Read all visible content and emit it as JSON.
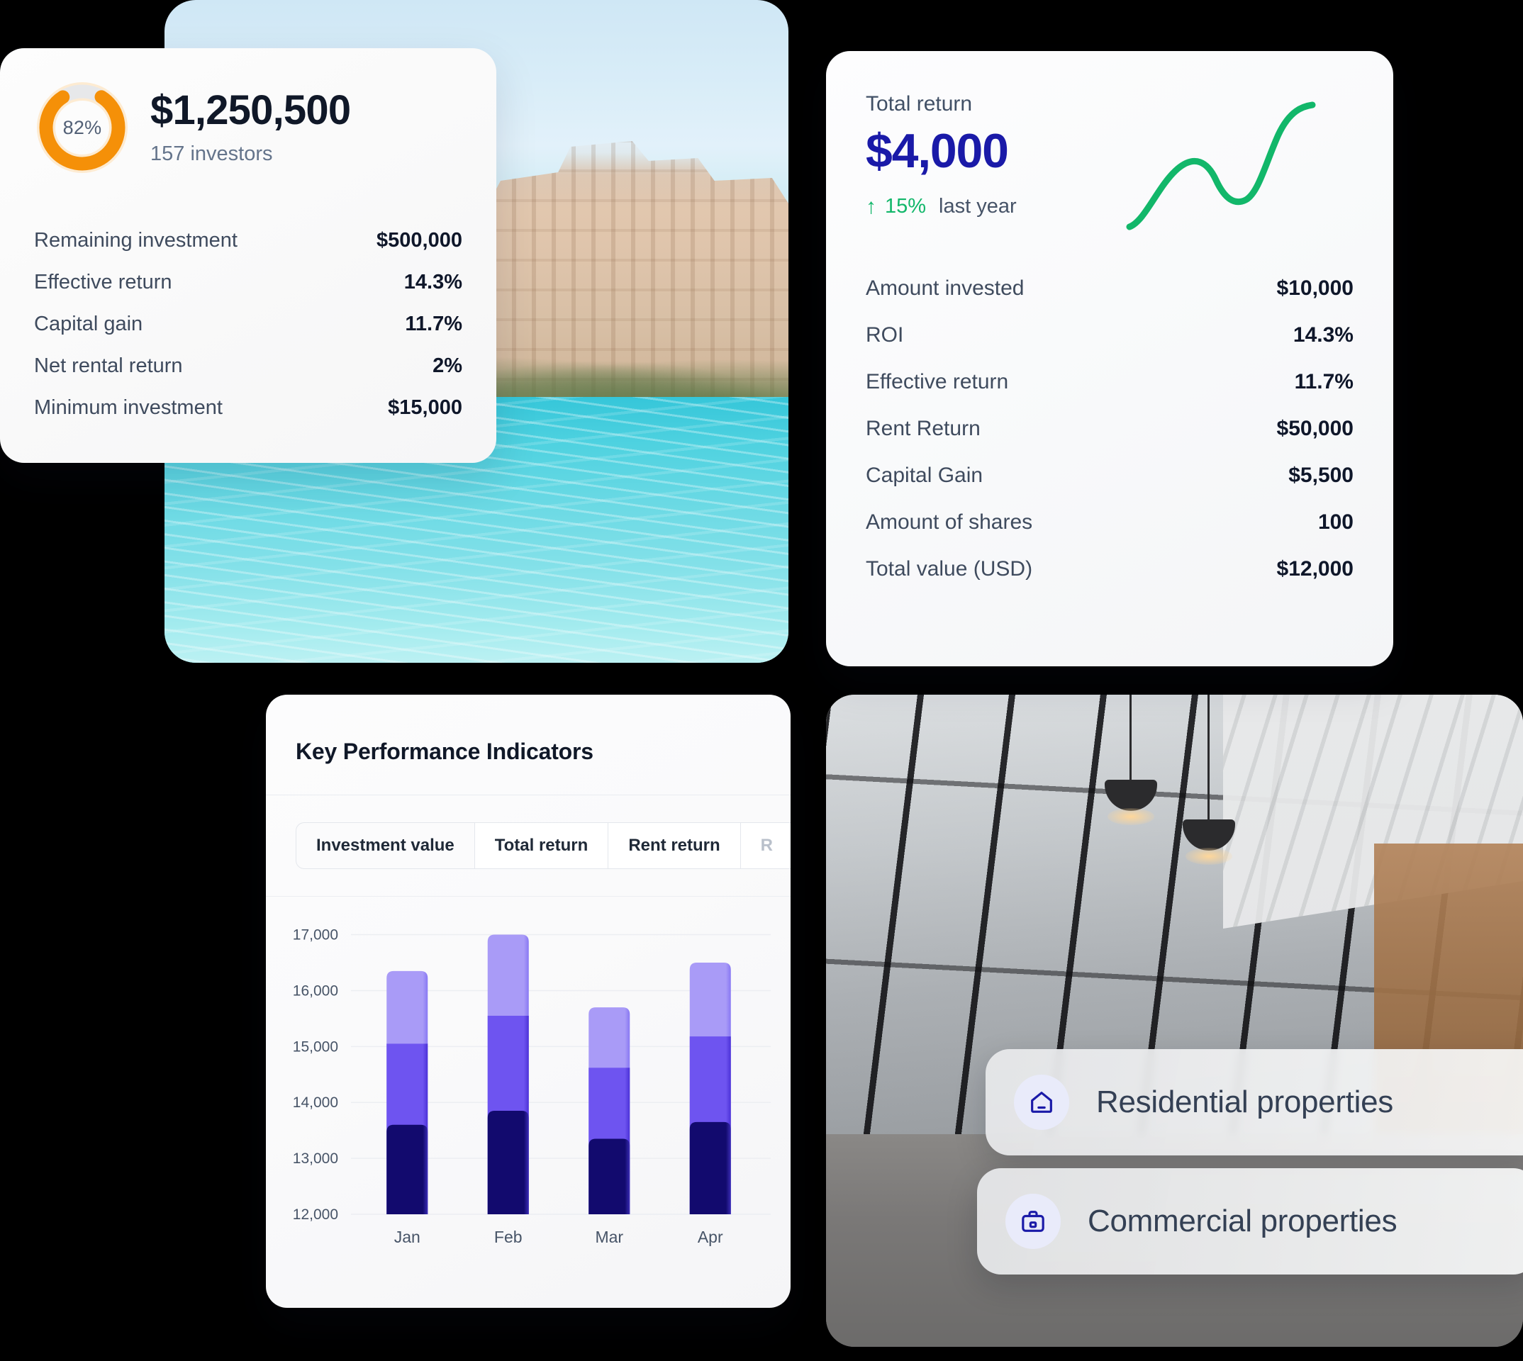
{
  "investment_card": {
    "progress_label": "82%",
    "progress_value": 82,
    "amount": "$1,250,500",
    "investors": "157 investors",
    "stats": [
      {
        "label": "Remaining investment",
        "value": "$500,000"
      },
      {
        "label": "Effective return",
        "value": "14.3%"
      },
      {
        "label": "Capital gain",
        "value": "11.7%"
      },
      {
        "label": "Net rental return",
        "value": "2%"
      },
      {
        "label": "Minimum investment",
        "value": "$15,000"
      }
    ]
  },
  "return_card": {
    "title": "Total return",
    "amount": "$4,000",
    "delta_arrow": "↑",
    "delta_value": "15%",
    "delta_period": "last year",
    "rows": [
      {
        "label": "Amount invested",
        "value": "$10,000"
      },
      {
        "label": "ROI",
        "value": "14.3%"
      },
      {
        "label": "Effective return",
        "value": "11.7%"
      },
      {
        "label": "Rent Return",
        "value": "$50,000"
      },
      {
        "label": "Capital Gain",
        "value": "$5,500"
      },
      {
        "label": "Amount of shares",
        "value": "100"
      },
      {
        "label": "Total value (USD)",
        "value": "$12,000"
      }
    ]
  },
  "kpi_card": {
    "title": "Key Performance Indicators",
    "tabs": [
      {
        "label": "Investment value",
        "active": true
      },
      {
        "label": "Total return",
        "active": false
      },
      {
        "label": "Rent return",
        "active": false
      },
      {
        "label": "R",
        "active": false
      }
    ]
  },
  "property_pills": [
    {
      "label": "Residential properties",
      "icon": "home-icon"
    },
    {
      "label": "Commercial properties",
      "icon": "briefcase-icon"
    }
  ],
  "colors": {
    "donut_accent": "#F59008",
    "donut_track": "#E7E8EA",
    "return_accent": "#1A1AA8",
    "positive": "#12B76A",
    "bar_bottom": "#120A6E",
    "bar_middle": "#6E54F0",
    "bar_top": "#A99BF7",
    "icon_navy": "#1A1AA8"
  },
  "chart_data": {
    "type": "bar",
    "stacked": true,
    "title": "Key Performance Indicators",
    "xlabel": "",
    "ylabel": "",
    "ylim": [
      12000,
      17400
    ],
    "grid": true,
    "legend": "none",
    "categories": [
      "Jan",
      "Feb",
      "Mar",
      "Apr"
    ],
    "ytick_labels": [
      "17,000",
      "16,000",
      "15,000",
      "14,000",
      "13,000",
      "12,000"
    ],
    "yticks": [
      17000,
      16000,
      15000,
      14000,
      13000,
      12000
    ],
    "series": [
      {
        "name": "segment-1",
        "color": "#120A6E",
        "values": [
          13600,
          13850,
          13350,
          13650
        ]
      },
      {
        "name": "segment-2",
        "color": "#6E54F0",
        "values": [
          15050,
          15550,
          14620,
          15180
        ]
      },
      {
        "name": "segment-3",
        "color": "#A99BF7",
        "values": [
          16350,
          17000,
          15700,
          16500
        ]
      }
    ],
    "totals": [
      16350,
      17000,
      15700,
      16500
    ]
  }
}
